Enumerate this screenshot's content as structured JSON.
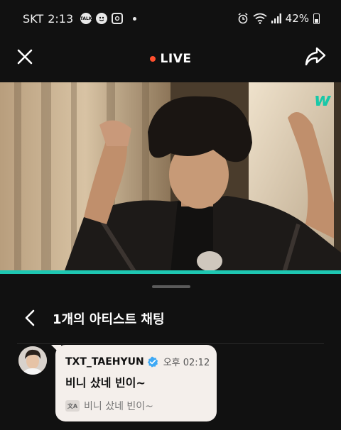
{
  "status_bar": {
    "carrier": "SKT",
    "time": "2:13",
    "talk_icon_text": "TALK",
    "battery": "42%",
    "icons": [
      "talk-icon",
      "emoji-app-icon",
      "instagram-icon",
      "alarm-icon",
      "wifi-icon",
      "signal-icon",
      "battery-icon"
    ]
  },
  "top_bar": {
    "live_label": "LIVE",
    "live_color": "#ff4f2e",
    "close_icon": "close-icon",
    "share_icon": "share-icon"
  },
  "video": {
    "logo": "w",
    "logo_color": "#18c8a8",
    "progress_color": "#1ec7b2",
    "progress": 1.0
  },
  "chat": {
    "title": "1개의 아티스트 채팅",
    "back_icon": "chevron-left-icon",
    "messages": [
      {
        "author": "TXT_TAEHYUN",
        "verified": true,
        "time": "오후 02:12",
        "text": "비니 샀네 빈이~",
        "translation": "비니 샀네 빈이~",
        "translate_icon_text": "文A"
      }
    ]
  },
  "colors": {
    "background": "#111111",
    "bubble": "#f4efeb",
    "verified": "#3ea9f5"
  }
}
